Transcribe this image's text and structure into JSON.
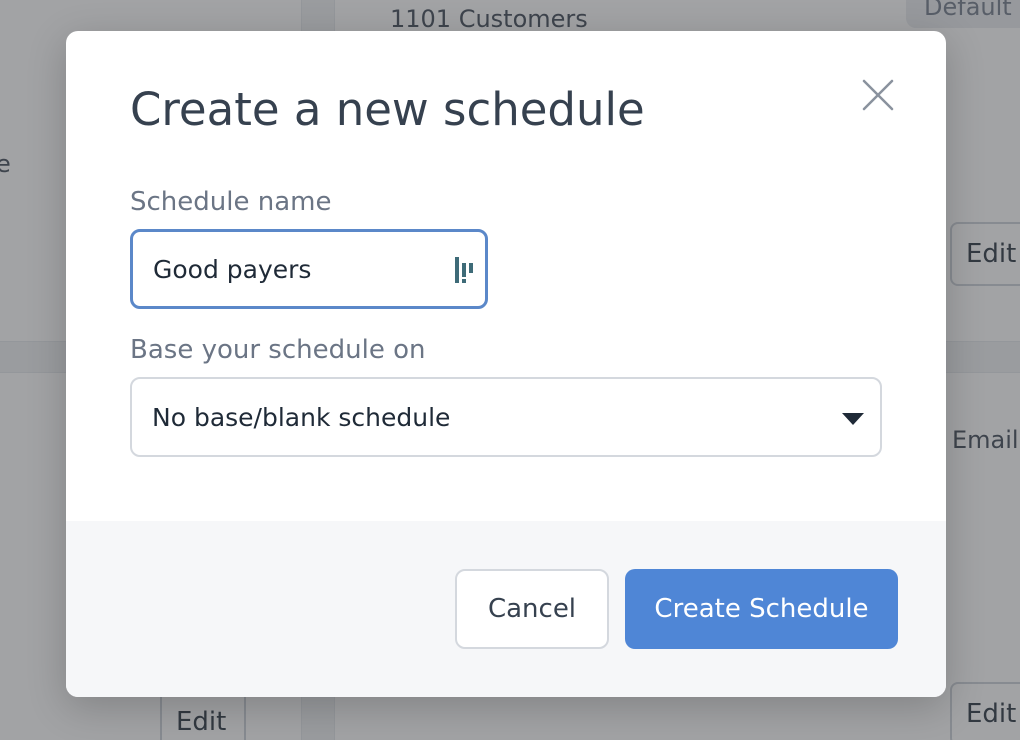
{
  "background": {
    "customers_text": "1101 Customers",
    "default_pill": "Default",
    "left_partial_text": "e",
    "email_partial_text": "Email",
    "edit_button_label": "Edit"
  },
  "modal": {
    "title": "Create a new schedule",
    "close_icon": "close-icon",
    "schedule_name": {
      "label": "Schedule name",
      "value": "Good payers",
      "extension_icon": "autofill-extension-icon"
    },
    "base_schedule": {
      "label": "Base your schedule on",
      "selected": "No base/blank schedule",
      "caret_icon": "caret-down-icon"
    },
    "footer": {
      "cancel_label": "Cancel",
      "create_label": "Create Schedule"
    }
  },
  "colors": {
    "primary": "#4f86d6",
    "focus_border": "#5b88c9",
    "title_text": "#36414f",
    "label_text": "#6b7585",
    "footer_bg": "#f6f7f9",
    "overlay": "rgba(70, 72, 76, 0.5)"
  }
}
